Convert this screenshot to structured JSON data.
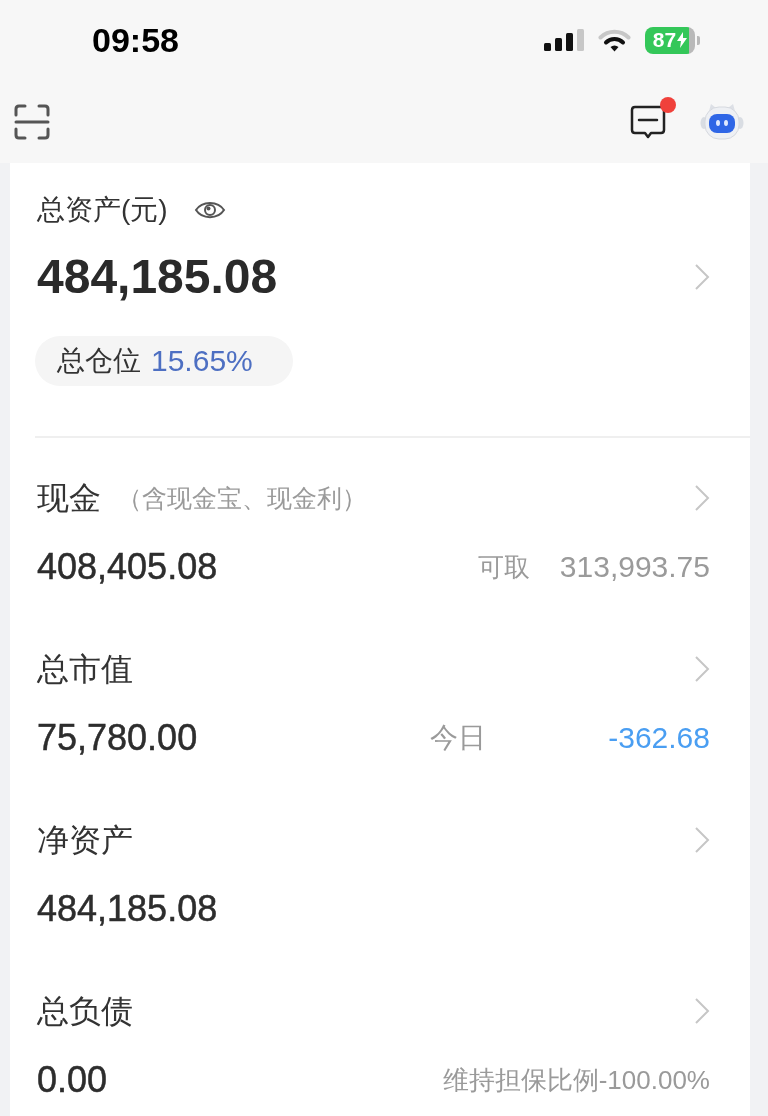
{
  "status_bar": {
    "time": "09:58",
    "battery": "87"
  },
  "nav": {
    "messages": {
      "unread": true
    }
  },
  "summary": {
    "title": "总资产(元)",
    "amount": "484,185.08",
    "position": {
      "label": "总仓位",
      "value": "15.65%"
    }
  },
  "sections": [
    {
      "title": "现金",
      "note": "（含现金宝、现金利）",
      "value": "408,405.08",
      "extra": {
        "kind": "inline",
        "label": "可取",
        "value": "313,993.75",
        "negative": false
      }
    },
    {
      "title": "总市值",
      "value": "75,780.00",
      "extra": {
        "kind": "split",
        "label": "今日",
        "value": "-362.68",
        "negative": true
      }
    },
    {
      "title": "净资产",
      "value": "484,185.08"
    },
    {
      "title": "总负债",
      "value": "0.00",
      "extra": {
        "kind": "text",
        "value": "维持担保比例-100.00%"
      }
    }
  ]
}
